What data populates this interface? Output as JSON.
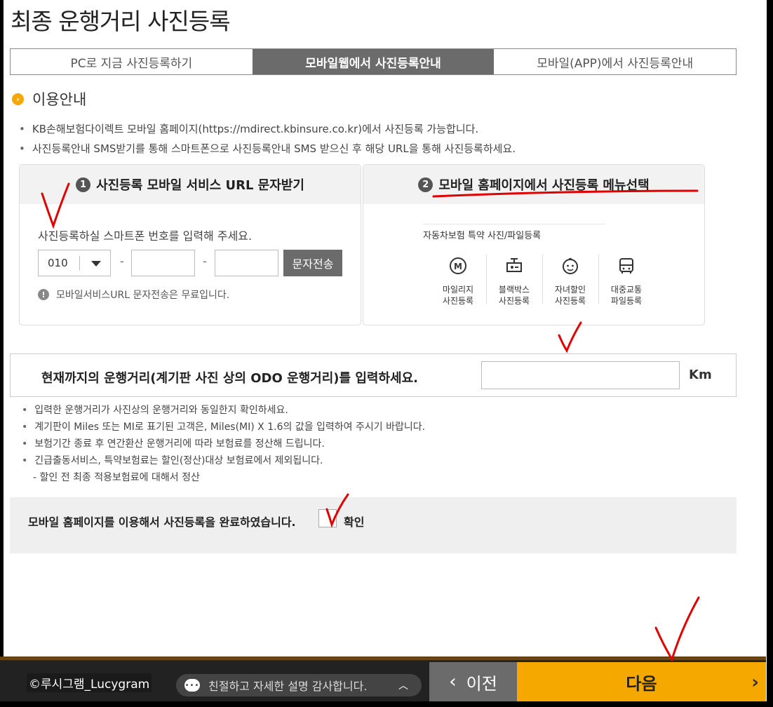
{
  "page_title": "최종 운행거리 사진등록",
  "tabs": [
    {
      "label": "PC로 지금 사진등록하기",
      "active": false
    },
    {
      "label": "모바일웹에서 사진등록안내",
      "active": true
    },
    {
      "label": "모바일(APP)에서 사진등록안내",
      "active": false
    }
  ],
  "section": {
    "title": "이용안내"
  },
  "info": [
    "KB손해보험다이렉트 모바일 홈페이지(https://mdirect.kbinsure.co.kr)에서 사진등록 가능합니다.",
    "사진등록안내 SMS받기를 통해 스마트폰으로 사진등록안내 SMS 받으신 후 해당 URL을 통해 사진등록하세요."
  ],
  "step1": {
    "number": "1",
    "title": "사진등록 모바일 서비스 URL 문자받기",
    "prompt": "사진등록하실 스마트폰 번호를 입력해 주세요.",
    "phone_prefix": "010",
    "dash": "-",
    "send_label": "문자전송",
    "notice": "모바일서비스URL 문자전송은 무료입니다."
  },
  "step2": {
    "number": "2",
    "title": "모바일 홈페이지에서 사진등록 메뉴선택",
    "menu_title": "자동차보험 특약 사진/파일등록",
    "items": [
      {
        "icon": "mileage-icon",
        "line1": "마일리지",
        "line2": "사진등록"
      },
      {
        "icon": "blackbox-icon",
        "line1": "블랙박스",
        "line2": "사진등록"
      },
      {
        "icon": "child-icon",
        "line1": "자녀할인",
        "line2": "사진등록"
      },
      {
        "icon": "bus-icon",
        "line1": "대중교통",
        "line2": "파일등록"
      }
    ]
  },
  "odo": {
    "label": "현재까지의 운행거리(계기판 사진 상의 ODO 운행거리)를 입력하세요.",
    "value": "",
    "unit": "Km"
  },
  "notes": [
    "입력한 운행거리가 사진상의 운행거리와 동일한지 확인하세요.",
    "계기판이 Miles 또는 MI로 표기된 고객은, Miles(MI) X 1.6의 값을 입력하여 주시기 바랍니다.",
    "보험기간 종료 후 연간환산 운행거리에 따라 보험료를 정산해 드립니다.",
    "긴급출동서비스, 특약보험료는 할인(정산)대상 보험료에서 제외됩니다."
  ],
  "note_sub": "- 할인 전 최종 적용보험료에 대해서 정산",
  "confirm": {
    "text": "모바일 홈페이지를 이용해서 사진등록을 완료하였습니다.",
    "checkbox_label": "확인"
  },
  "footer": {
    "copyright": "©루시그램_Lucygram",
    "chat_text": "친절하고 자세한 설명 감사합니다.",
    "prev_label": "이전",
    "next_label": "다음"
  },
  "colors": {
    "accent": "#f5a800",
    "tab_active": "#6b6b6b",
    "annotation": "#e00000"
  }
}
